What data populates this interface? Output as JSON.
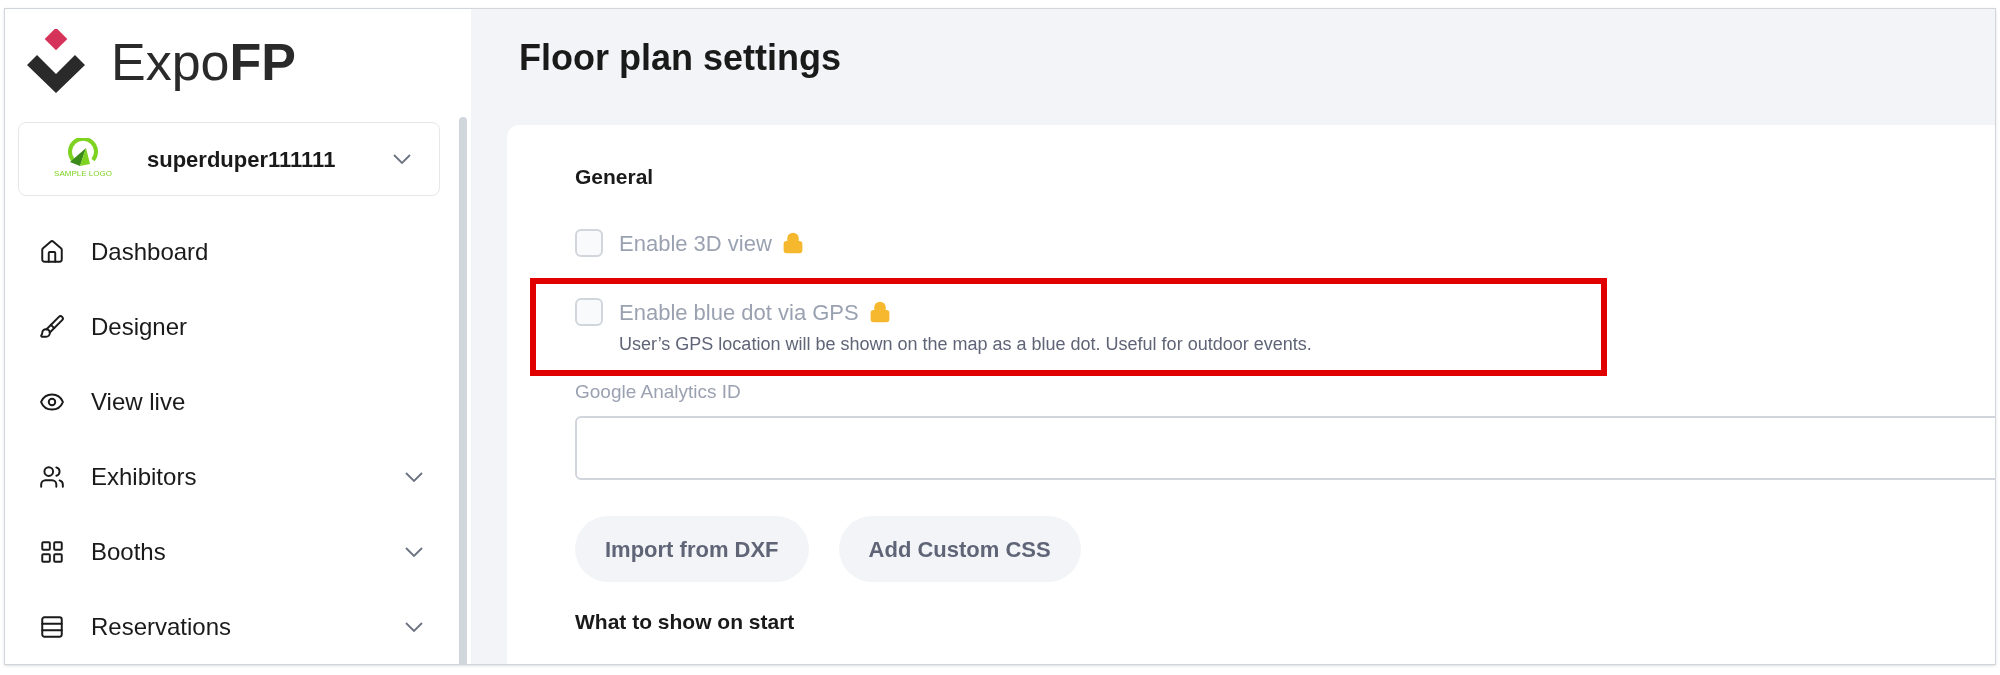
{
  "brand": {
    "light": "Expo",
    "bold": "FP"
  },
  "organization": {
    "logo_caption": "SAMPLE LOGO",
    "name": "superduper111111"
  },
  "nav": [
    {
      "label": "Dashboard",
      "expandable": false
    },
    {
      "label": "Designer",
      "expandable": false
    },
    {
      "label": "View live",
      "expandable": false
    },
    {
      "label": "Exhibitors",
      "expandable": true
    },
    {
      "label": "Booths",
      "expandable": true
    },
    {
      "label": "Reservations",
      "expandable": true
    }
  ],
  "page_title": "Floor plan settings",
  "section_title": "General",
  "options": [
    {
      "label": "Enable 3D view",
      "checked": false,
      "locked": true,
      "highlighted": false
    },
    {
      "label": "Enable blue dot via GPS",
      "description": "User’s GPS location will be shown on the map as a blue dot. Useful for outdoor events.",
      "checked": false,
      "locked": true,
      "highlighted": true
    }
  ],
  "analytics_field": {
    "label": "Google Analytics ID"
  },
  "buttons": [
    "Import from DXF",
    "Add Custom CSS"
  ],
  "next_section_title": "What to show on start"
}
